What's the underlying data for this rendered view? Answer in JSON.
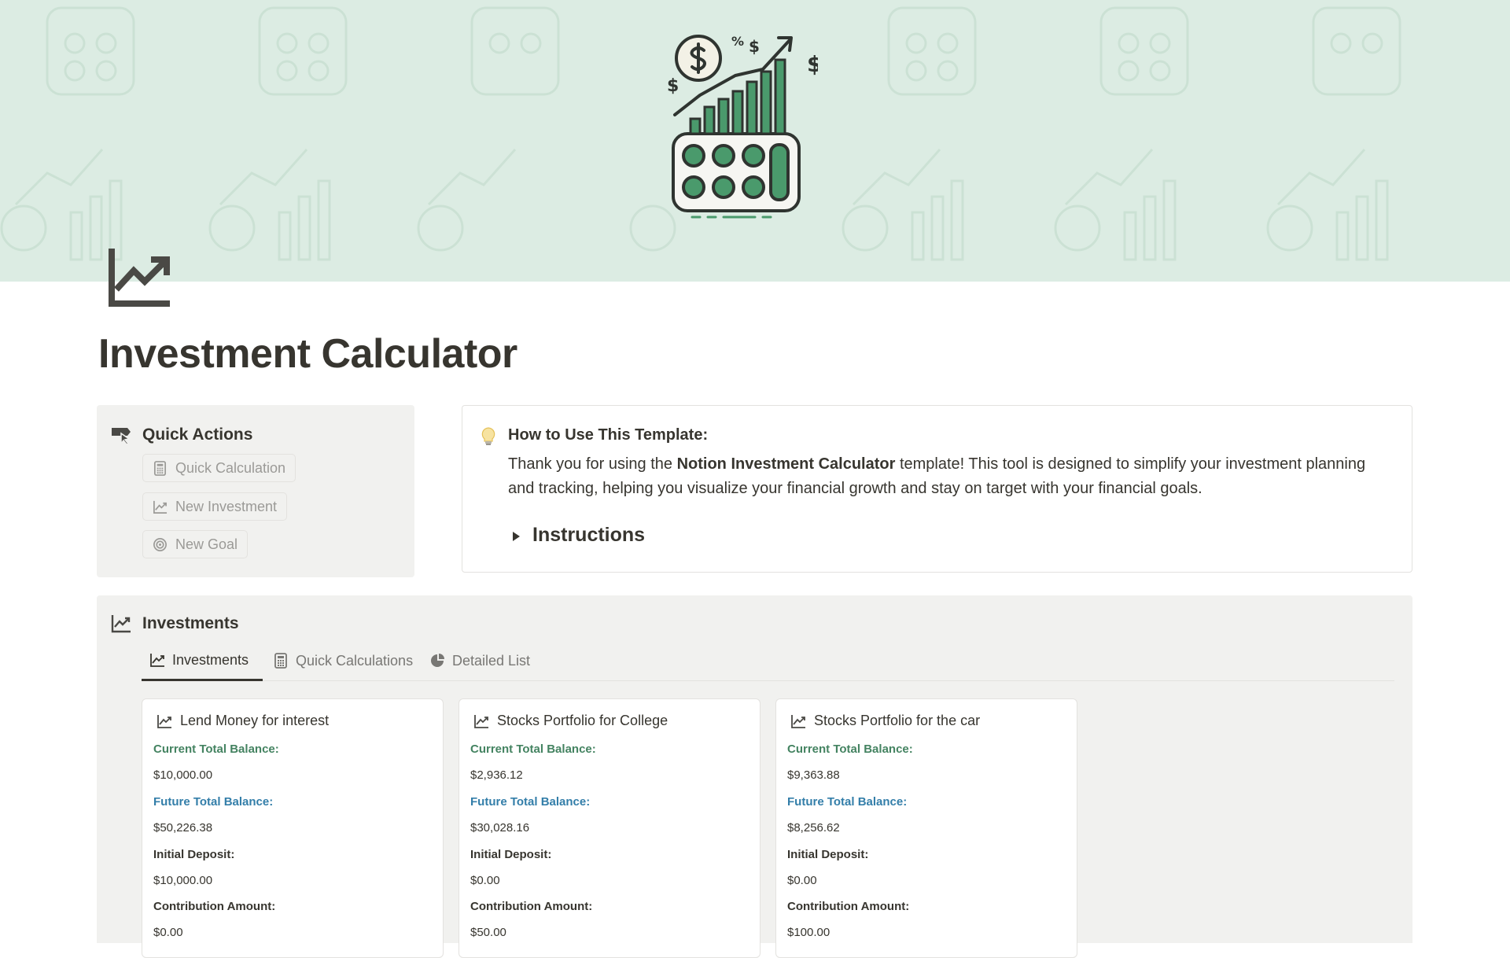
{
  "page": {
    "title": "Investment Calculator"
  },
  "quick_actions": {
    "title": "Quick Actions",
    "buttons": [
      {
        "label": "Quick Calculation",
        "icon": "calculator-icon"
      },
      {
        "label": "New Investment",
        "icon": "chart-line-icon"
      },
      {
        "label": "New Goal",
        "icon": "target-icon"
      }
    ]
  },
  "callout": {
    "icon": "lightbulb-icon",
    "heading": "How to Use This Template:",
    "body_before": "Thank you for using the ",
    "body_bold": "Notion Investment Calculator",
    "body_after": " template! This tool is designed to simplify your investment planning and tracking, helping you visualize your financial growth and stay on target with your financial goals.",
    "toggle_label": "Instructions"
  },
  "investments": {
    "title": "Investments",
    "tabs": [
      {
        "label": "Investments",
        "icon": "chart-line-icon",
        "active": true
      },
      {
        "label": "Quick Calculations",
        "icon": "calculator-icon",
        "active": false
      },
      {
        "label": "Detailed List",
        "icon": "pie-chart-icon",
        "active": false
      }
    ],
    "field_labels": {
      "current": "Current Total Balance:",
      "future": "Future Total Balance:",
      "initial": "Initial Deposit:",
      "contribution": "Contribution Amount:"
    },
    "cards": [
      {
        "title": "Lend Money for interest",
        "current": "$10,000.00",
        "future": "$50,226.38",
        "initial": "$10,000.00",
        "contribution": "$0.00"
      },
      {
        "title": "Stocks Portfolio for College",
        "current": "$2,936.12",
        "future": "$30,028.16",
        "initial": "$0.00",
        "contribution": "$50.00"
      },
      {
        "title": "Stocks Portfolio for the car",
        "current": "$9,363.88",
        "future": "$8,256.62",
        "initial": "$0.00",
        "contribution": "$100.00"
      }
    ]
  },
  "colors": {
    "cover_bg": "#dcece3",
    "green_label": "#448361",
    "blue_label": "#337ea9",
    "panel_bg": "#f1f1ef",
    "text": "#37352f"
  }
}
